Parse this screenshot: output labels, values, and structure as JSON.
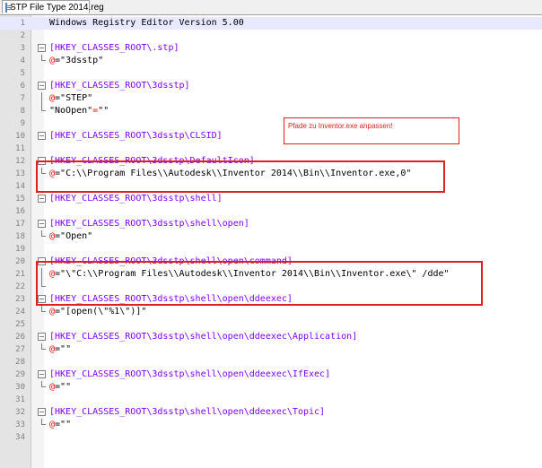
{
  "tab": {
    "title": "STP File Type 2014.reg",
    "icon": "reg-file-icon"
  },
  "annotation": {
    "text": "Pfade zu Inventor.exe anpassen!",
    "color": "#e02020"
  },
  "current_line": 1,
  "lines": [
    {
      "num": "1",
      "fold": "none",
      "segments": [
        {
          "t": "plain",
          "v": "Windows Registry Editor Version 5.00"
        }
      ]
    },
    {
      "num": "2",
      "fold": "none",
      "segments": []
    },
    {
      "num": "3",
      "fold": "open",
      "segments": [
        {
          "t": "key",
          "v": "[HKEY_CLASSES_ROOT\\.stp]"
        }
      ]
    },
    {
      "num": "4",
      "fold": "end",
      "segments": [
        {
          "t": "at",
          "v": "@"
        },
        {
          "t": "plain",
          "v": "=\"3dsstp\""
        }
      ]
    },
    {
      "num": "5",
      "fold": "none",
      "segments": []
    },
    {
      "num": "6",
      "fold": "open",
      "segments": [
        {
          "t": "key",
          "v": "[HKEY_CLASSES_ROOT\\3dsstp]"
        }
      ]
    },
    {
      "num": "7",
      "fold": "mid",
      "segments": [
        {
          "t": "at",
          "v": "@"
        },
        {
          "t": "plain",
          "v": "=\"STEP\""
        }
      ]
    },
    {
      "num": "8",
      "fold": "end",
      "segments": [
        {
          "t": "plain",
          "v": "\"NoOpen\""
        },
        {
          "t": "at",
          "v": "="
        },
        {
          "t": "plain",
          "v": "\"\""
        }
      ]
    },
    {
      "num": "9",
      "fold": "none",
      "segments": []
    },
    {
      "num": "10",
      "fold": "open",
      "segments": [
        {
          "t": "key",
          "v": "[HKEY_CLASSES_ROOT\\3dsstp\\CLSID]"
        }
      ]
    },
    {
      "num": "11",
      "fold": "none",
      "segments": []
    },
    {
      "num": "12",
      "fold": "open",
      "segments": [
        {
          "t": "key",
          "v": "[HKEY_CLASSES_ROOT\\3dsstp\\DefaultIcon]"
        }
      ]
    },
    {
      "num": "13",
      "fold": "end",
      "segments": [
        {
          "t": "at",
          "v": "@"
        },
        {
          "t": "plain",
          "v": "=\"C:\\\\Program Files\\\\Autodesk\\\\Inventor 2014\\\\Bin\\\\Inventor.exe,0\""
        }
      ]
    },
    {
      "num": "14",
      "fold": "none",
      "segments": []
    },
    {
      "num": "15",
      "fold": "open",
      "segments": [
        {
          "t": "key",
          "v": "[HKEY_CLASSES_ROOT\\3dsstp\\shell]"
        }
      ]
    },
    {
      "num": "16",
      "fold": "none",
      "segments": []
    },
    {
      "num": "17",
      "fold": "open",
      "segments": [
        {
          "t": "key",
          "v": "[HKEY_CLASSES_ROOT\\3dsstp\\shell\\open]"
        }
      ]
    },
    {
      "num": "18",
      "fold": "end",
      "segments": [
        {
          "t": "at",
          "v": "@"
        },
        {
          "t": "plain",
          "v": "=\"Open\""
        }
      ]
    },
    {
      "num": "19",
      "fold": "none",
      "segments": []
    },
    {
      "num": "20",
      "fold": "open",
      "segments": [
        {
          "t": "key",
          "v": "[HKEY_CLASSES_ROOT\\3dsstp\\shell\\open\\command]"
        }
      ]
    },
    {
      "num": "21",
      "fold": "mid",
      "segments": [
        {
          "t": "at",
          "v": "@"
        },
        {
          "t": "plain",
          "v": "=\"\\\"C:\\\\Program Files\\\\Autodesk\\\\Inventor 2014\\\\Bin\\\\Inventor.exe\\\" /dde\""
        }
      ]
    },
    {
      "num": "22",
      "fold": "end",
      "segments": []
    },
    {
      "num": "23",
      "fold": "open",
      "segments": [
        {
          "t": "key",
          "v": "[HKEY_CLASSES_ROOT\\3dsstp\\shell\\open\\ddeexec]"
        }
      ]
    },
    {
      "num": "24",
      "fold": "end",
      "segments": [
        {
          "t": "at",
          "v": "@"
        },
        {
          "t": "plain",
          "v": "=\"[open(\\\"%1\\\")]\""
        }
      ]
    },
    {
      "num": "25",
      "fold": "none",
      "segments": []
    },
    {
      "num": "26",
      "fold": "open",
      "segments": [
        {
          "t": "key",
          "v": "[HKEY_CLASSES_ROOT\\3dsstp\\shell\\open\\ddeexec\\Application]"
        }
      ]
    },
    {
      "num": "27",
      "fold": "end",
      "segments": [
        {
          "t": "at",
          "v": "@"
        },
        {
          "t": "plain",
          "v": "=\"\""
        }
      ]
    },
    {
      "num": "28",
      "fold": "none",
      "segments": []
    },
    {
      "num": "29",
      "fold": "open",
      "segments": [
        {
          "t": "key",
          "v": "[HKEY_CLASSES_ROOT\\3dsstp\\shell\\open\\ddeexec\\IfExec]"
        }
      ]
    },
    {
      "num": "30",
      "fold": "end",
      "segments": [
        {
          "t": "at",
          "v": "@"
        },
        {
          "t": "plain",
          "v": "=\"\""
        }
      ]
    },
    {
      "num": "31",
      "fold": "none",
      "segments": []
    },
    {
      "num": "32",
      "fold": "open",
      "segments": [
        {
          "t": "key",
          "v": "[HKEY_CLASSES_ROOT\\3dsstp\\shell\\open\\ddeexec\\Topic]"
        }
      ]
    },
    {
      "num": "33",
      "fold": "end",
      "segments": [
        {
          "t": "at",
          "v": "@"
        },
        {
          "t": "plain",
          "v": "=\"\""
        }
      ]
    },
    {
      "num": "34",
      "fold": "none",
      "segments": []
    }
  ],
  "colors": {
    "key": "#8000ff",
    "at": "#ff0000",
    "text": "#000000",
    "highlight_box": "#e02020"
  }
}
